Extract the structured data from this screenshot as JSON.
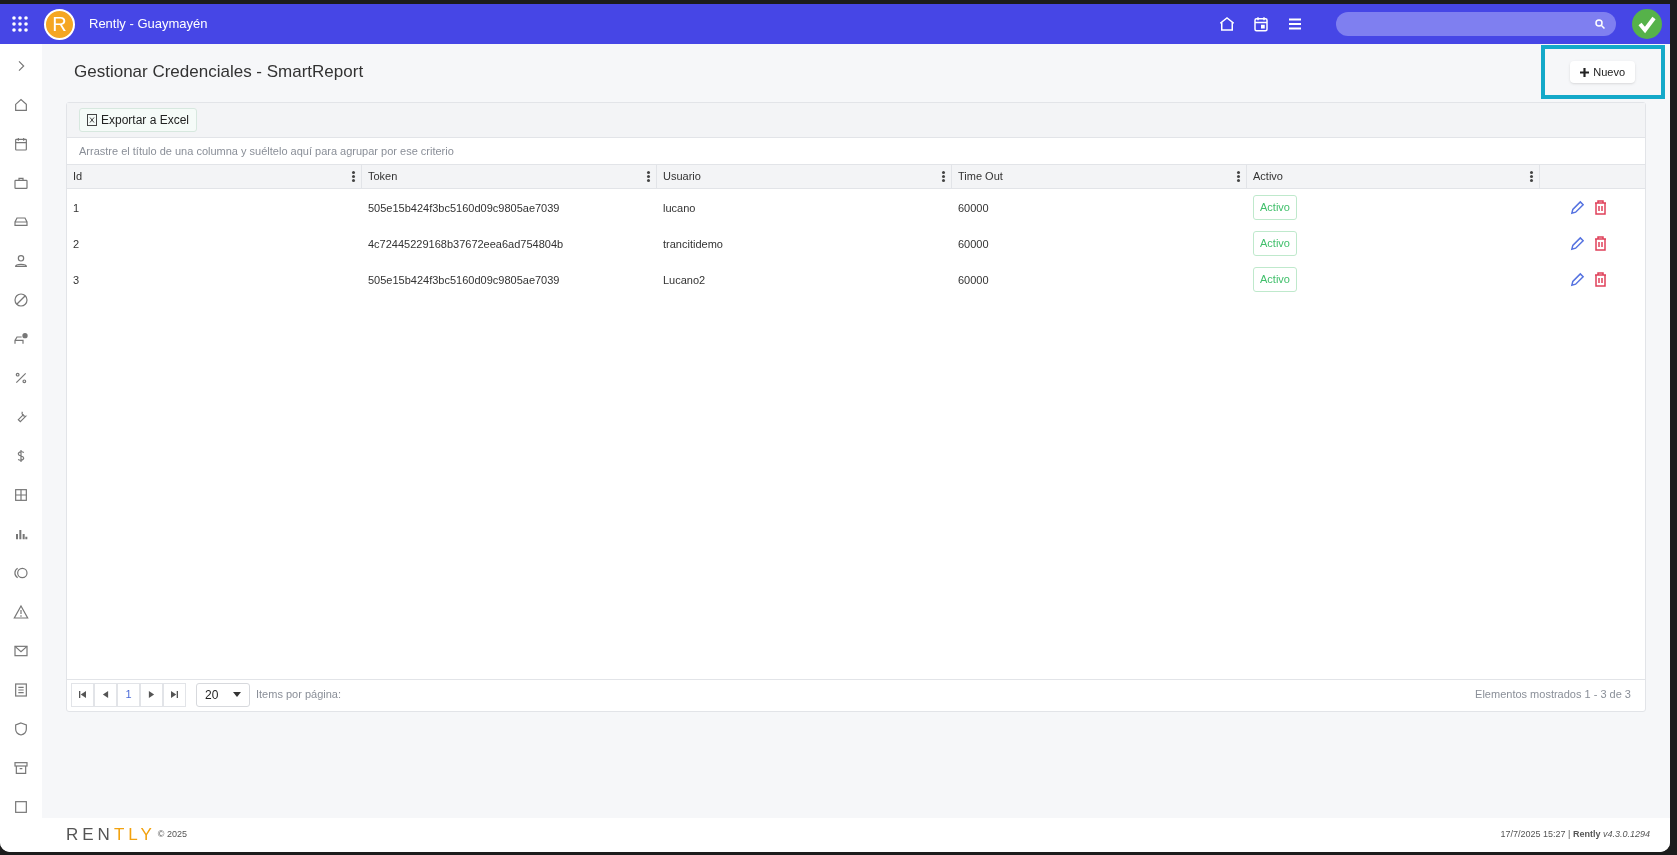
{
  "top_bar": {
    "app_title": "Rently - Guaymayén",
    "logo_letter": "R"
  },
  "page": {
    "title": "Gestionar Credenciales - SmartReport",
    "new_button": {
      "label": "Nuevo",
      "highlighted": true
    }
  },
  "grid": {
    "export_button": "Exportar a Excel",
    "group_hint": "Arrastre el título de una columna y suéltelo aquí para agrupar por ese criterio",
    "columns": [
      "Id",
      "Token",
      "Usuario",
      "Time Out",
      "Activo"
    ],
    "rows": [
      {
        "id": "1",
        "token": "505e15b424f3bc5160d09c9805ae7039",
        "usuario": "lucano",
        "time_out": "60000",
        "activo": "Activo"
      },
      {
        "id": "2",
        "token": "4c72445229168b37672eea6ad754804b",
        "usuario": "trancitidemo",
        "time_out": "60000",
        "activo": "Activo"
      },
      {
        "id": "3",
        "token": "505e15b424f3bc5160d09c9805ae7039",
        "usuario": "Lucano2",
        "time_out": "60000",
        "activo": "Activo"
      }
    ],
    "pager": {
      "pages": [
        {
          "label": "1",
          "selected": true
        }
      ],
      "page_size": "20",
      "page_size_label": "Items por página:",
      "summary": "Elementos mostrados 1 - 3 de 3"
    }
  },
  "footer": {
    "logo": [
      "REN",
      "TLY"
    ],
    "copyright": "© 2025",
    "info": "17/7/2025 15:27 | **Rently** *v4.3.0.1294*"
  }
}
